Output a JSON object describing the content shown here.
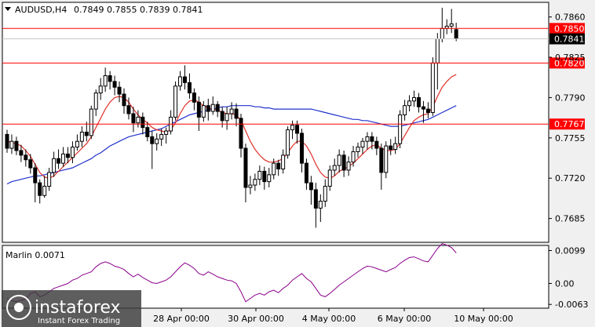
{
  "header": {
    "symbol": "AUDUSD,H4",
    "ohlc": "0.7849 0.7855 0.7839 0.7841"
  },
  "indicator": {
    "label": "Marlin 0.0071",
    "ticks": [
      "0.0099",
      "0.00",
      "-0.0063"
    ]
  },
  "watermark": {
    "brand": "instaforex",
    "tagline": "Instant Forex Trading"
  },
  "colors": {
    "background": "#ffffff",
    "frame": "#f0f0f0",
    "bull": "#ffffff",
    "bear": "#000000",
    "level_line": "#ff0000",
    "label_bg": "#ff0000",
    "price_label_bg": "#000000",
    "ma_fast": "#e0302a",
    "ma_slow": "#2233cc",
    "oscillator": "#8a008a"
  },
  "chart_data": {
    "type": "candlestick",
    "y_range": [
      0.7665,
      0.7872
    ],
    "y_ticks": [
      "0.7860",
      "0.7825",
      "0.7790",
      "0.7755",
      "0.7720",
      "0.7685"
    ],
    "x_tick_labels": [
      "28 Apr 00:00",
      "30 Apr 00:00",
      "4 May 00:00",
      "6 May 00:00",
      "10 May 00:00"
    ],
    "levels": [
      {
        "value": 0.785,
        "label": "0.7850"
      },
      {
        "value": 0.782,
        "label": "0.7820"
      },
      {
        "value": 0.7767,
        "label": "0.7767"
      }
    ],
    "current_price": {
      "value": 0.7841,
      "label": "0.7841"
    },
    "candles": [
      [
        0.7758,
        0.7746,
        0.7762,
        0.7742
      ],
      [
        0.7746,
        0.7752,
        0.7758,
        0.7741
      ],
      [
        0.7752,
        0.7744,
        0.7756,
        0.774
      ],
      [
        0.7744,
        0.774,
        0.7749,
        0.7734
      ],
      [
        0.774,
        0.7736,
        0.7745,
        0.773
      ],
      [
        0.7736,
        0.7729,
        0.7741,
        0.7724
      ],
      [
        0.7729,
        0.7716,
        0.7733,
        0.7699
      ],
      [
        0.7716,
        0.7705,
        0.7719,
        0.7698
      ],
      [
        0.7705,
        0.7713,
        0.7722,
        0.7703
      ],
      [
        0.7713,
        0.7725,
        0.7729,
        0.7709
      ],
      [
        0.7725,
        0.7737,
        0.7743,
        0.7721
      ],
      [
        0.7737,
        0.7733,
        0.7745,
        0.7728
      ],
      [
        0.7733,
        0.7741,
        0.7747,
        0.773
      ],
      [
        0.7741,
        0.7738,
        0.7747,
        0.7733
      ],
      [
        0.7738,
        0.7747,
        0.7752,
        0.7733
      ],
      [
        0.7747,
        0.7752,
        0.7758,
        0.7744
      ],
      [
        0.7752,
        0.776,
        0.7765,
        0.7747
      ],
      [
        0.776,
        0.7757,
        0.7769,
        0.7752
      ],
      [
        0.7757,
        0.778,
        0.7783,
        0.7754
      ],
      [
        0.778,
        0.7794,
        0.7797,
        0.7774
      ],
      [
        0.7794,
        0.78,
        0.7807,
        0.7788
      ],
      [
        0.78,
        0.7809,
        0.7816,
        0.7795
      ],
      [
        0.7809,
        0.7804,
        0.7813,
        0.7797
      ],
      [
        0.7804,
        0.7799,
        0.7809,
        0.7792
      ],
      [
        0.7799,
        0.7793,
        0.7804,
        0.7786
      ],
      [
        0.7793,
        0.7783,
        0.7798,
        0.7776
      ],
      [
        0.7783,
        0.7776,
        0.779,
        0.7771
      ],
      [
        0.7776,
        0.7768,
        0.7782,
        0.776
      ],
      [
        0.7768,
        0.7773,
        0.7779,
        0.7764
      ],
      [
        0.7773,
        0.7764,
        0.7777,
        0.7758
      ],
      [
        0.7764,
        0.7756,
        0.7769,
        0.7752
      ],
      [
        0.7756,
        0.775,
        0.7761,
        0.7728
      ],
      [
        0.775,
        0.7754,
        0.7759,
        0.7744
      ],
      [
        0.7754,
        0.7758,
        0.7763,
        0.7748
      ],
      [
        0.7758,
        0.7761,
        0.7764,
        0.775
      ],
      [
        0.7761,
        0.7773,
        0.7779,
        0.7758
      ],
      [
        0.7773,
        0.78,
        0.7804,
        0.777
      ],
      [
        0.78,
        0.7808,
        0.7813,
        0.7796
      ],
      [
        0.7808,
        0.7803,
        0.7818,
        0.7797
      ],
      [
        0.7803,
        0.7794,
        0.7811,
        0.7789
      ],
      [
        0.7794,
        0.7786,
        0.7798,
        0.7779
      ],
      [
        0.7786,
        0.7773,
        0.7791,
        0.7761
      ],
      [
        0.7773,
        0.7783,
        0.7787,
        0.7769
      ],
      [
        0.7783,
        0.7778,
        0.7789,
        0.777
      ],
      [
        0.7778,
        0.7784,
        0.7791,
        0.7775
      ],
      [
        0.7784,
        0.7778,
        0.7787,
        0.7773
      ],
      [
        0.7778,
        0.777,
        0.7782,
        0.7764
      ],
      [
        0.777,
        0.7776,
        0.7782,
        0.7762
      ],
      [
        0.7776,
        0.778,
        0.7786,
        0.7771
      ],
      [
        0.778,
        0.7772,
        0.7785,
        0.7765
      ],
      [
        0.7772,
        0.7746,
        0.7776,
        0.7738
      ],
      [
        0.7746,
        0.7712,
        0.775,
        0.7699
      ],
      [
        0.7712,
        0.7714,
        0.7722,
        0.7706
      ],
      [
        0.7714,
        0.7719,
        0.7724,
        0.7709
      ],
      [
        0.7719,
        0.7726,
        0.7731,
        0.7714
      ],
      [
        0.7726,
        0.7717,
        0.773,
        0.771
      ],
      [
        0.7717,
        0.7723,
        0.7729,
        0.7712
      ],
      [
        0.7723,
        0.7733,
        0.7737,
        0.7719
      ],
      [
        0.7733,
        0.7728,
        0.7736,
        0.7722
      ],
      [
        0.7728,
        0.774,
        0.7745,
        0.7724
      ],
      [
        0.774,
        0.7762,
        0.7765,
        0.7737
      ],
      [
        0.7762,
        0.7766,
        0.777,
        0.7754
      ],
      [
        0.7766,
        0.7759,
        0.777,
        0.775
      ],
      [
        0.7759,
        0.7733,
        0.7763,
        0.7725
      ],
      [
        0.7733,
        0.7716,
        0.7737,
        0.771
      ],
      [
        0.7716,
        0.771,
        0.7722,
        0.7697
      ],
      [
        0.771,
        0.7694,
        0.7716,
        0.7677
      ],
      [
        0.7694,
        0.77,
        0.7706,
        0.7682
      ],
      [
        0.77,
        0.7713,
        0.7719,
        0.7695
      ],
      [
        0.7713,
        0.7727,
        0.7731,
        0.7709
      ],
      [
        0.7727,
        0.7731,
        0.7737,
        0.7722
      ],
      [
        0.7731,
        0.774,
        0.7745,
        0.7725
      ],
      [
        0.774,
        0.7727,
        0.7744,
        0.7721
      ],
      [
        0.7727,
        0.7734,
        0.7739,
        0.7722
      ],
      [
        0.7734,
        0.7743,
        0.7748,
        0.773
      ],
      [
        0.7743,
        0.7747,
        0.7751,
        0.7738
      ],
      [
        0.7747,
        0.7752,
        0.7755,
        0.7741
      ],
      [
        0.7752,
        0.7756,
        0.776,
        0.7745
      ],
      [
        0.7756,
        0.7752,
        0.776,
        0.7745
      ],
      [
        0.7752,
        0.7746,
        0.7756,
        0.774
      ],
      [
        0.7746,
        0.7725,
        0.775,
        0.771
      ],
      [
        0.7725,
        0.7748,
        0.7752,
        0.772
      ],
      [
        0.7748,
        0.7745,
        0.7754,
        0.774
      ],
      [
        0.7745,
        0.775,
        0.7756,
        0.7741
      ],
      [
        0.775,
        0.7775,
        0.7779,
        0.7746
      ],
      [
        0.7775,
        0.7783,
        0.7788,
        0.777
      ],
      [
        0.7783,
        0.7787,
        0.7792,
        0.7778
      ],
      [
        0.7787,
        0.779,
        0.7796,
        0.7782
      ],
      [
        0.779,
        0.7782,
        0.7794,
        0.7777
      ],
      [
        0.7782,
        0.778,
        0.7787,
        0.7768
      ],
      [
        0.778,
        0.7777,
        0.7786,
        0.7772
      ],
      [
        0.7777,
        0.782,
        0.7825,
        0.7774
      ],
      [
        0.782,
        0.7841,
        0.7846,
        0.7797
      ],
      [
        0.7841,
        0.785,
        0.7868,
        0.7838
      ],
      [
        0.785,
        0.7852,
        0.7858,
        0.7845
      ],
      [
        0.7852,
        0.7854,
        0.7867,
        0.7846
      ],
      [
        0.7849,
        0.7841,
        0.7855,
        0.7839
      ]
    ],
    "ma_fast": [
      0.7752,
      0.7751,
      0.775,
      0.7748,
      0.7744,
      0.7739,
      0.7732,
      0.7725,
      0.7721,
      0.772,
      0.7722,
      0.7726,
      0.773,
      0.7734,
      0.7738,
      0.7742,
      0.7746,
      0.775,
      0.7756,
      0.7764,
      0.7772,
      0.778,
      0.7786,
      0.779,
      0.7791,
      0.779,
      0.7786,
      0.778,
      0.7775,
      0.7771,
      0.7768,
      0.7764,
      0.7762,
      0.7761,
      0.776,
      0.7762,
      0.7768,
      0.7776,
      0.7783,
      0.7787,
      0.7788,
      0.7786,
      0.7783,
      0.7781,
      0.778,
      0.7779,
      0.7777,
      0.7776,
      0.7776,
      0.7775,
      0.777,
      0.7761,
      0.7752,
      0.7745,
      0.774,
      0.7736,
      0.7734,
      0.7734,
      0.7735,
      0.7737,
      0.7742,
      0.7748,
      0.7752,
      0.7752,
      0.7748,
      0.7741,
      0.7732,
      0.7725,
      0.7721,
      0.772,
      0.7722,
      0.7726,
      0.7728,
      0.773,
      0.7733,
      0.7737,
      0.7741,
      0.7745,
      0.7748,
      0.7749,
      0.7746,
      0.7744,
      0.7744,
      0.7745,
      0.775,
      0.7757,
      0.7764,
      0.777,
      0.7773,
      0.7775,
      0.7776,
      0.7782,
      0.7791,
      0.7799,
      0.7804,
      0.7808,
      0.781
    ],
    "ma_slow": [
      0.7715,
      0.7717,
      0.7718,
      0.7719,
      0.772,
      0.7721,
      0.7722,
      0.7722,
      0.7723,
      0.7724,
      0.7725,
      0.7726,
      0.7727,
      0.7728,
      0.7729,
      0.7731,
      0.7733,
      0.7735,
      0.7737,
      0.774,
      0.7742,
      0.7745,
      0.7748,
      0.775,
      0.7752,
      0.7754,
      0.7756,
      0.7757,
      0.7758,
      0.7759,
      0.776,
      0.7761,
      0.7762,
      0.7763,
      0.7765,
      0.7767,
      0.7769,
      0.7771,
      0.7773,
      0.7775,
      0.7776,
      0.7777,
      0.7778,
      0.7779,
      0.778,
      0.7781,
      0.7782,
      0.7782,
      0.7783,
      0.7783,
      0.7783,
      0.7783,
      0.7783,
      0.7782,
      0.7782,
      0.7781,
      0.7781,
      0.778,
      0.778,
      0.778,
      0.778,
      0.778,
      0.778,
      0.778,
      0.778,
      0.778,
      0.7779,
      0.7778,
      0.7777,
      0.7776,
      0.7775,
      0.7774,
      0.7773,
      0.7772,
      0.7771,
      0.7771,
      0.777,
      0.777,
      0.7769,
      0.7768,
      0.7767,
      0.7766,
      0.7765,
      0.7765,
      0.7765,
      0.7766,
      0.7767,
      0.7768,
      0.7769,
      0.777,
      0.7771,
      0.7773,
      0.7775,
      0.7777,
      0.7779,
      0.7781,
      0.7783
    ],
    "oscillator": [
      -0.0045,
      -0.0052,
      -0.0055,
      -0.005,
      -0.0047,
      -0.003,
      -0.0025,
      -0.004,
      -0.0035,
      -0.0025,
      -0.0015,
      -0.001,
      -0.0005,
      0.0,
      0.001,
      0.0015,
      0.0025,
      0.003,
      0.0035,
      0.005,
      0.006,
      0.0065,
      0.006,
      0.0052,
      0.0048,
      0.0042,
      0.003,
      0.002,
      0.0028,
      0.0018,
      0.001,
      0.0002,
      0.0,
      0.0005,
      0.001,
      0.002,
      0.0035,
      0.005,
      0.0062,
      0.0055,
      0.0045,
      0.003,
      0.0025,
      0.0035,
      0.0028,
      0.002,
      0.0015,
      0.001,
      0.0008,
      0.0,
      -0.0025,
      -0.0055,
      -0.0045,
      -0.0035,
      -0.003,
      -0.0035,
      -0.0025,
      -0.002,
      -0.0028,
      -0.0015,
      -0.0005,
      0.001,
      0.002,
      0.003,
      0.0015,
      0.0005,
      -0.0015,
      -0.0035,
      -0.004,
      -0.003,
      -0.0018,
      -0.0005,
      0.0005,
      0.0015,
      0.0025,
      0.0035,
      0.0045,
      0.0052,
      0.005,
      0.0045,
      0.004,
      0.0035,
      0.0042,
      0.0048,
      0.006,
      0.007,
      0.0078,
      0.008,
      0.0074,
      0.0068,
      0.0065,
      0.0085,
      0.0105,
      0.012,
      0.0115,
      0.0108,
      0.0092
    ]
  }
}
